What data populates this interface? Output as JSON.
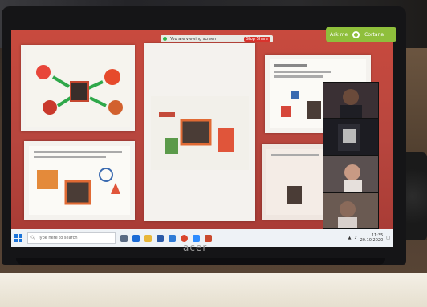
{
  "zoom_bar": {
    "status": "You are viewing screen",
    "stop_label": "Stop Share"
  },
  "cortana": {
    "label": "Cortana",
    "sub": "Ask me"
  },
  "taskbar": {
    "search_placeholder": "Type here to search",
    "time": "11:35",
    "date": "20.10.2020"
  },
  "gallery": {
    "thumbs": [
      {
        "label": ""
      },
      {
        "label": ""
      },
      {
        "label": ""
      },
      {
        "label": ""
      }
    ]
  },
  "laptop": {
    "brand": "acer"
  },
  "colors": {
    "slide_bg": "#b8463e",
    "cortana": "#8fbf3c",
    "taskbar": "#eef2f6"
  }
}
